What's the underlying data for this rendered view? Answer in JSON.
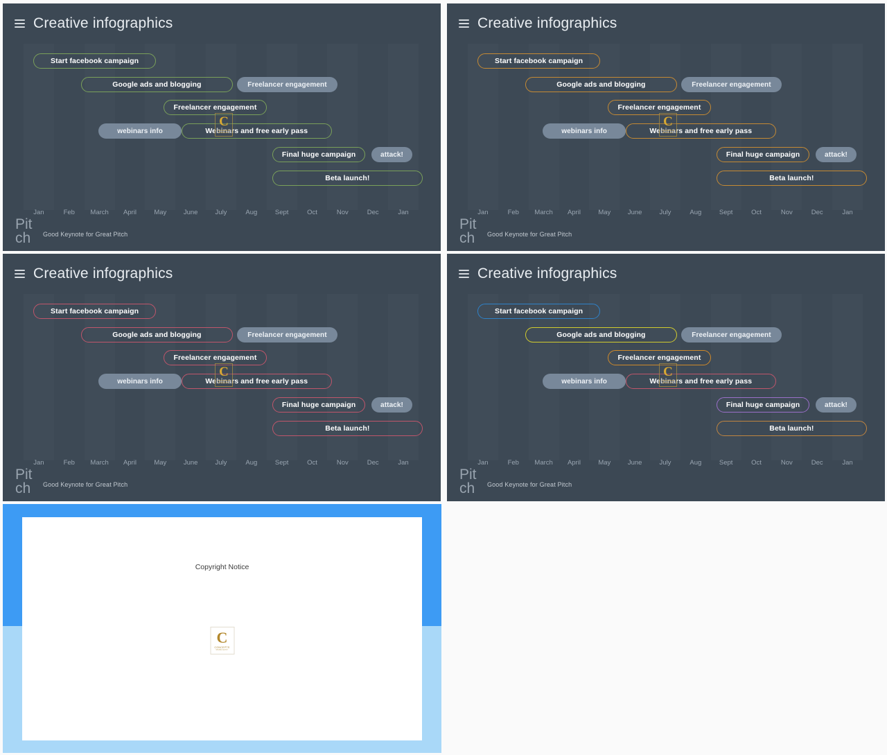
{
  "panels": [
    {
      "id": "top-left",
      "title": "Creative infographics",
      "accent": "#7aa05a",
      "footer_brand": "Pitch",
      "footer_sub": "Good Keynote for Great Pitch"
    },
    {
      "id": "top-right",
      "title": "Creative infographics",
      "accent": "#c58a34",
      "footer_brand": "Pitch",
      "footer_sub": "Good Keynote for Great Pitch"
    },
    {
      "id": "bottom-left",
      "title": "Creative infographics",
      "accent": "#c0566b",
      "footer_brand": "Pitch",
      "footer_sub": "Good Keynote for Great Pitch"
    },
    {
      "id": "bottom-right",
      "title": "Creative infographics",
      "accent": "#c58a34",
      "footer_brand": "Pitch",
      "footer_sub": "Good Keynote for Great Pitch"
    }
  ],
  "filled_pill_color": "#78889a",
  "chart_data": [
    {
      "type": "bar",
      "title": "Creative infographics",
      "orientation": "horizontal-gantt",
      "categories": [
        "Jan",
        "Feb",
        "March",
        "April",
        "May",
        "June",
        "July",
        "Aug",
        "Sept",
        "Oct",
        "Nov",
        "Dec",
        "Jan"
      ],
      "xlabel": "",
      "ylabel": "",
      "grid": true,
      "legend": "none",
      "tasks": [
        {
          "label": "Start facebook campaign",
          "row": 0,
          "start_pct": 2.5,
          "width_pct": 31.0,
          "style": "outline",
          "color": "#7aa05a"
        },
        {
          "label": "Google ads and blogging",
          "row": 1,
          "start_pct": 14.5,
          "width_pct": 38.5,
          "style": "outline",
          "color": "#7aa05a"
        },
        {
          "label": "Freelancer engagement",
          "row": 1,
          "start_pct": 54.0,
          "width_pct": 25.5,
          "style": "filled",
          "color": "#78889a"
        },
        {
          "label": "Freelancer engagement",
          "row": 2,
          "start_pct": 35.5,
          "width_pct": 26.0,
          "style": "outline",
          "color": "#7aa05a"
        },
        {
          "label": "webinars info",
          "row": 3,
          "start_pct": 19.0,
          "width_pct": 21.0,
          "style": "filled",
          "color": "#78889a"
        },
        {
          "label": "Webinars and free early pass",
          "row": 3,
          "start_pct": 40.0,
          "width_pct": 38.0,
          "style": "outline",
          "color": "#7aa05a"
        },
        {
          "label": "Final huge campaign",
          "row": 4,
          "start_pct": 63.0,
          "width_pct": 23.5,
          "style": "outline",
          "color": "#7aa05a"
        },
        {
          "label": "attack!",
          "row": 4,
          "start_pct": 88.0,
          "width_pct": 10.5,
          "style": "filled",
          "color": "#78889a"
        },
        {
          "label": "Beta launch!",
          "row": 5,
          "start_pct": 63.0,
          "width_pct": 38.0,
          "style": "outline",
          "color": "#7aa05a"
        }
      ]
    },
    {
      "type": "bar",
      "title": "Creative infographics",
      "orientation": "horizontal-gantt",
      "categories": [
        "Jan",
        "Feb",
        "March",
        "April",
        "May",
        "June",
        "July",
        "Aug",
        "Sept",
        "Oct",
        "Nov",
        "Dec",
        "Jan"
      ],
      "xlabel": "",
      "ylabel": "",
      "grid": true,
      "legend": "none",
      "tasks": [
        {
          "label": "Start facebook campaign",
          "row": 0,
          "start_pct": 2.5,
          "width_pct": 31.0,
          "style": "outline",
          "color": "#c58a34"
        },
        {
          "label": "Google ads and blogging",
          "row": 1,
          "start_pct": 14.5,
          "width_pct": 38.5,
          "style": "outline",
          "color": "#c58a34"
        },
        {
          "label": "Freelancer engagement",
          "row": 1,
          "start_pct": 54.0,
          "width_pct": 25.5,
          "style": "filled",
          "color": "#78889a"
        },
        {
          "label": "Freelancer engagement",
          "row": 2,
          "start_pct": 35.5,
          "width_pct": 26.0,
          "style": "outline",
          "color": "#c58a34"
        },
        {
          "label": "webinars info",
          "row": 3,
          "start_pct": 19.0,
          "width_pct": 21.0,
          "style": "filled",
          "color": "#78889a"
        },
        {
          "label": "Webinars and free early pass",
          "row": 3,
          "start_pct": 40.0,
          "width_pct": 38.0,
          "style": "outline",
          "color": "#c58a34"
        },
        {
          "label": "Final huge campaign",
          "row": 4,
          "start_pct": 63.0,
          "width_pct": 23.5,
          "style": "outline",
          "color": "#c58a34"
        },
        {
          "label": "attack!",
          "row": 4,
          "start_pct": 88.0,
          "width_pct": 10.5,
          "style": "filled",
          "color": "#78889a"
        },
        {
          "label": "Beta launch!",
          "row": 5,
          "start_pct": 63.0,
          "width_pct": 38.0,
          "style": "outline",
          "color": "#c58a34"
        }
      ]
    },
    {
      "type": "bar",
      "title": "Creative infographics",
      "orientation": "horizontal-gantt",
      "categories": [
        "Jan",
        "Feb",
        "March",
        "April",
        "May",
        "June",
        "July",
        "Aug",
        "Sept",
        "Oct",
        "Nov",
        "Dec",
        "Jan"
      ],
      "xlabel": "",
      "ylabel": "",
      "grid": true,
      "legend": "none",
      "tasks": [
        {
          "label": "Start facebook campaign",
          "row": 0,
          "start_pct": 2.5,
          "width_pct": 31.0,
          "style": "outline",
          "color": "#c0566b"
        },
        {
          "label": "Google ads and blogging",
          "row": 1,
          "start_pct": 14.5,
          "width_pct": 38.5,
          "style": "outline",
          "color": "#c0566b"
        },
        {
          "label": "Freelancer engagement",
          "row": 1,
          "start_pct": 54.0,
          "width_pct": 25.5,
          "style": "filled",
          "color": "#78889a"
        },
        {
          "label": "Freelancer engagement",
          "row": 2,
          "start_pct": 35.5,
          "width_pct": 26.0,
          "style": "outline",
          "color": "#c0566b"
        },
        {
          "label": "webinars info",
          "row": 3,
          "start_pct": 19.0,
          "width_pct": 21.0,
          "style": "filled",
          "color": "#78889a"
        },
        {
          "label": "Webinars and free early pass",
          "row": 3,
          "start_pct": 40.0,
          "width_pct": 38.0,
          "style": "outline",
          "color": "#c0566b"
        },
        {
          "label": "Final huge campaign",
          "row": 4,
          "start_pct": 63.0,
          "width_pct": 23.5,
          "style": "outline",
          "color": "#c0566b"
        },
        {
          "label": "attack!",
          "row": 4,
          "start_pct": 88.0,
          "width_pct": 10.5,
          "style": "filled",
          "color": "#78889a"
        },
        {
          "label": "Beta launch!",
          "row": 5,
          "start_pct": 63.0,
          "width_pct": 38.0,
          "style": "outline",
          "color": "#c0566b"
        }
      ]
    },
    {
      "type": "bar",
      "title": "Creative infographics",
      "orientation": "horizontal-gantt",
      "categories": [
        "Jan",
        "Feb",
        "March",
        "April",
        "May",
        "June",
        "July",
        "Aug",
        "Sept",
        "Oct",
        "Nov",
        "Dec",
        "Jan"
      ],
      "xlabel": "",
      "ylabel": "",
      "grid": true,
      "legend": "none",
      "tasks": [
        {
          "label": "Start facebook campaign",
          "row": 0,
          "start_pct": 2.5,
          "width_pct": 31.0,
          "style": "outline",
          "color": "#2f82c9"
        },
        {
          "label": "Google ads and blogging",
          "row": 1,
          "start_pct": 14.5,
          "width_pct": 38.5,
          "style": "outline",
          "color": "#d2cc2e"
        },
        {
          "label": "Freelancer engagement",
          "row": 1,
          "start_pct": 54.0,
          "width_pct": 25.5,
          "style": "filled",
          "color": "#78889a"
        },
        {
          "label": "Freelancer engagement",
          "row": 2,
          "start_pct": 35.5,
          "width_pct": 26.0,
          "style": "outline",
          "color": "#d08a2a"
        },
        {
          "label": "webinars info",
          "row": 3,
          "start_pct": 19.0,
          "width_pct": 21.0,
          "style": "filled",
          "color": "#78889a"
        },
        {
          "label": "Webinars and free early pass",
          "row": 3,
          "start_pct": 40.0,
          "width_pct": 38.0,
          "style": "outline",
          "color": "#c0566b"
        },
        {
          "label": "Final huge campaign",
          "row": 4,
          "start_pct": 63.0,
          "width_pct": 23.5,
          "style": "outline",
          "color": "#9b6fc9"
        },
        {
          "label": "attack!",
          "row": 4,
          "start_pct": 88.0,
          "width_pct": 10.5,
          "style": "filled",
          "color": "#78889a"
        },
        {
          "label": "Beta launch!",
          "row": 5,
          "start_pct": 63.0,
          "width_pct": 38.0,
          "style": "outline",
          "color": "#c08540"
        }
      ]
    }
  ],
  "watermark": {
    "letter": "C",
    "name": "CONCEPTS",
    "tagline": "MADE EASY"
  },
  "copyright_slide": {
    "title": "Copyright Notice",
    "logo_letter": "C",
    "logo_name": "CONCEPTS",
    "logo_tagline": "MADE EASY",
    "bg_top": "#3d9bf4",
    "bg_bottom": "#a9d8f8"
  }
}
